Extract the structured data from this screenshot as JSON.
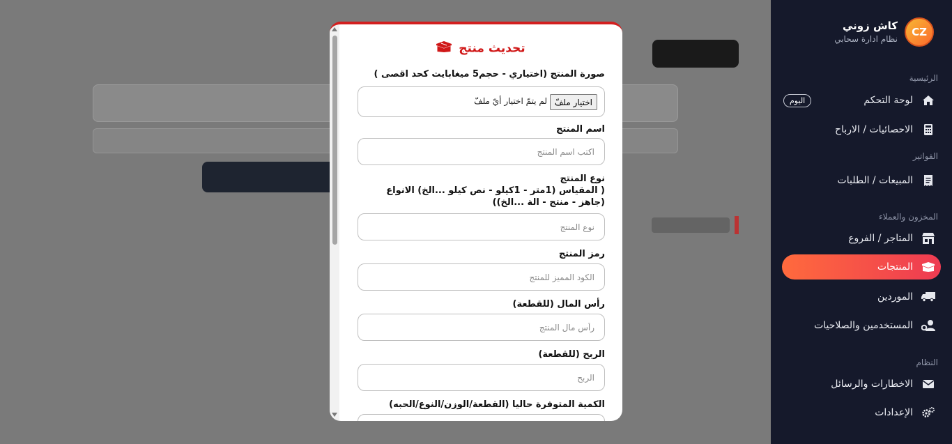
{
  "sidebar": {
    "brand_name": "كاش زوني",
    "brand_sub": "نظام ادارة سحابي",
    "logo_text": "CZ",
    "sections": {
      "main": "الرئيسية",
      "invoices": "الفواتير",
      "inventory": "المخزون والعملاء",
      "system": "النظام"
    },
    "items": [
      {
        "label": "لوحة التحكم",
        "icon": "home-icon",
        "badge": "اليوم"
      },
      {
        "label": "الاحصائيات / الارباح",
        "icon": "calculator-icon"
      },
      {
        "label": "المبيعات / الطلبات",
        "icon": "receipt-icon"
      },
      {
        "label": "المتاجر / الفروع",
        "icon": "store-icon"
      },
      {
        "label": "المنتجات",
        "icon": "box-icon",
        "active": true
      },
      {
        "label": "الموردين",
        "icon": "truck-icon"
      },
      {
        "label": "المستخدمين والصلاحيات",
        "icon": "user-gear-icon"
      },
      {
        "label": "الاخطارات والرسائل",
        "icon": "envelope-icon"
      },
      {
        "label": "الإعدادات",
        "icon": "gears-icon"
      }
    ]
  },
  "modal": {
    "title": "تحديث منتج",
    "image_label": "صورة المنتج (اختياري - حجم5 ميغابايت كحد اقصى )",
    "file_button": "اختيار ملفّ",
    "file_status": "لم يتمّ اختيار أيّ ملفّ",
    "name_label": "اسم المنتج",
    "name_placeholder": "اكتب اسم المنتج",
    "type_label": "نوع المنتج",
    "type_hint": "( المقياس (1متر - 1كيلو - نص كيلو ...الخ) الانواع (جاهز - منتج - الة ...الخ))",
    "type_placeholder": "نوع المنتج",
    "code_label": "رمز المنتج",
    "code_placeholder": "الكود المميز للمنتج",
    "cost_label": "رأس المال (للقطعة)",
    "cost_placeholder": "رأس مال المنتج",
    "profit_label": "الربح (للقطعة)",
    "profit_placeholder": "الربح",
    "qty_label": "الكمية المتوفرة حاليا (القطعة/الوزن/النوع/الحبه)"
  },
  "colors": {
    "sidebar_bg": "#15192b",
    "accent_start": "#ff6a3d",
    "accent_end": "#ee3b52",
    "title_red": "#d01818"
  }
}
